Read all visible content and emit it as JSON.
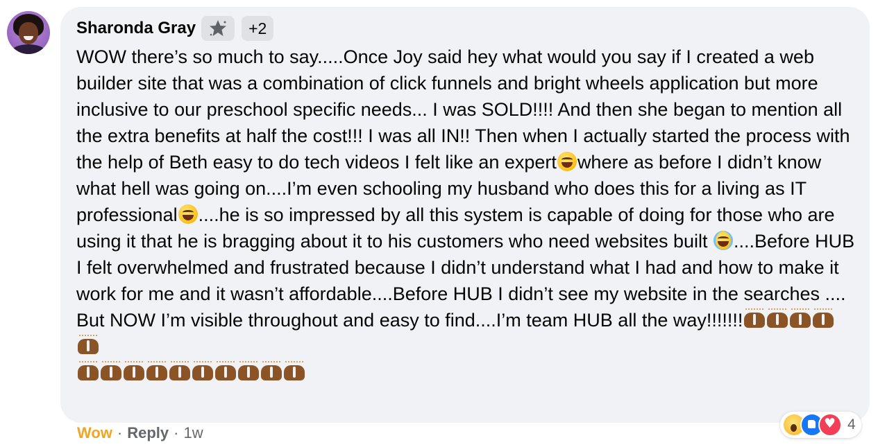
{
  "comment": {
    "author": "Sharonda Gray",
    "badge_icon": "star-badge-icon",
    "badge_more": "+2",
    "text_segments": [
      "WOW there’s so much to say.....Once Joy said hey what would you say if I created a web builder site that was a combination of click funnels and bright wheels application but more inclusive to our preschool specific needs... I was SOLD!!!! And then she began to mention all the extra benefits at half the cost!!! I was all IN!! Then when I actually started the process with the help of Beth easy to do tech videos I felt like an expert",
      "where as before I didn’t know what hell was going on....I’m even schooling my husband who does this for a living as IT professional",
      "....he is so impressed by all this system is capable of doing for those who are using it that he is bragging about it to his customers who need websites built ",
      "....Before HUB I felt overwhelmed and frustrated because I didn’t understand what I had and how to make it work for me and it wasn’t affordable....Before HUB I didn’t see my website in the searches .... But NOW I’m visible throughout and easy to find....I’m team HUB all the way!!!!!!!"
    ],
    "emoji_names": [
      "grinning-sweat-emoji",
      "grinning-sweat-emoji",
      "tears-of-joy-emoji",
      "raising-hands-emoji"
    ]
  },
  "actions": {
    "reaction_label": "Wow",
    "separator": "·",
    "reply_label": "Reply",
    "time": "1w"
  },
  "reactions": {
    "icons": [
      "wow-reaction-icon",
      "like-reaction-icon",
      "love-reaction-icon"
    ],
    "count": "4"
  },
  "colors": {
    "bubble_bg": "#f0f2f5",
    "wow_label": "#f0a624",
    "meta_text": "#65676b",
    "like_blue": "#1877f2",
    "love_red": "#f33e58"
  }
}
